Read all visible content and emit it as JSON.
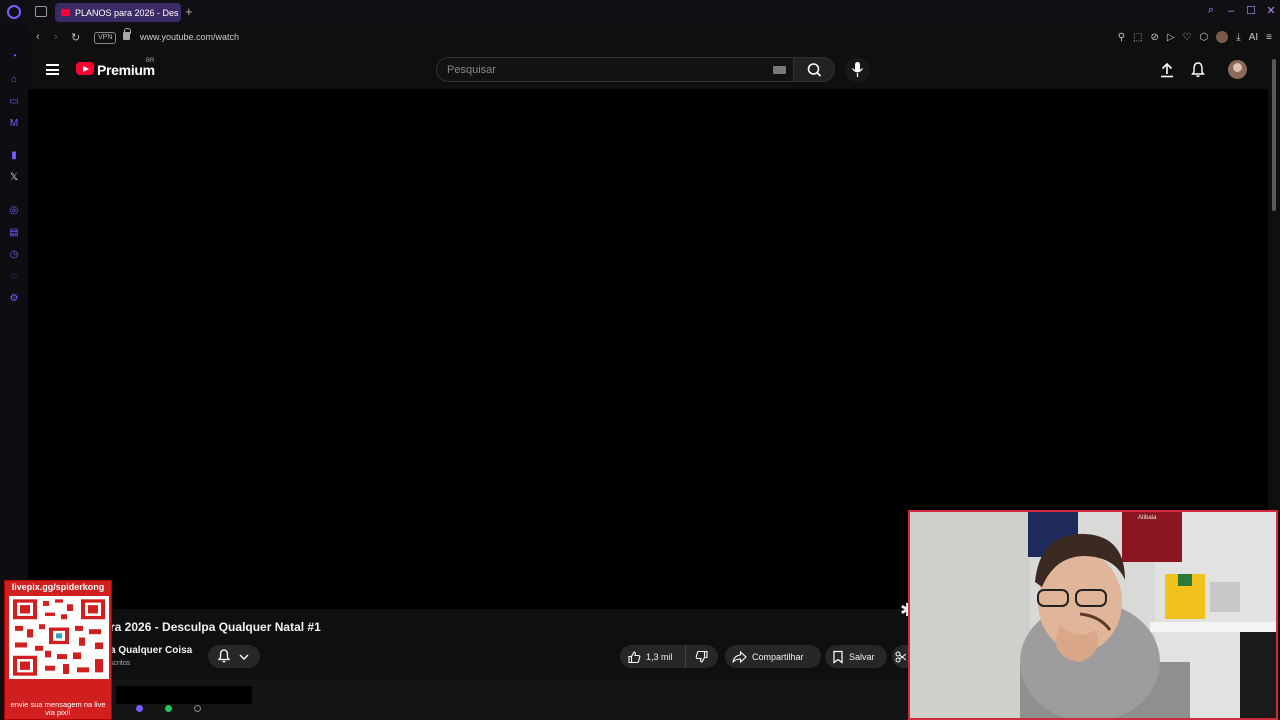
{
  "browser": {
    "tab_title": "PLANOS para 2026 - Des",
    "new_tab_label": "+",
    "vpn_label": "VPN",
    "url": "www.youtube.com/watch",
    "ai_label": "AI"
  },
  "youtube": {
    "brand": "Premium",
    "region": "BR",
    "search_placeholder": "Pesquisar",
    "video": {
      "title": "ra 2026 - Desculpa Qualquer Natal #1",
      "channel": "a Qualquer Coisa",
      "subscribers": "scritos"
    },
    "actions": {
      "like_count": "1,3 mil",
      "share_label": "Compartilhar",
      "save_label": "Salvar"
    }
  },
  "overlay": {
    "qr_top_text": "livepix.gg/spiderkong",
    "qr_bottom_text": "envie sua mensagem na live via pix!!",
    "webcam_wall_text": "Atibaia"
  },
  "colors": {
    "youtube_red": "#ff0033",
    "browser_accent": "#7b5cff",
    "webcam_border": "#d12a3c",
    "qr_card": "#d11f1f"
  }
}
